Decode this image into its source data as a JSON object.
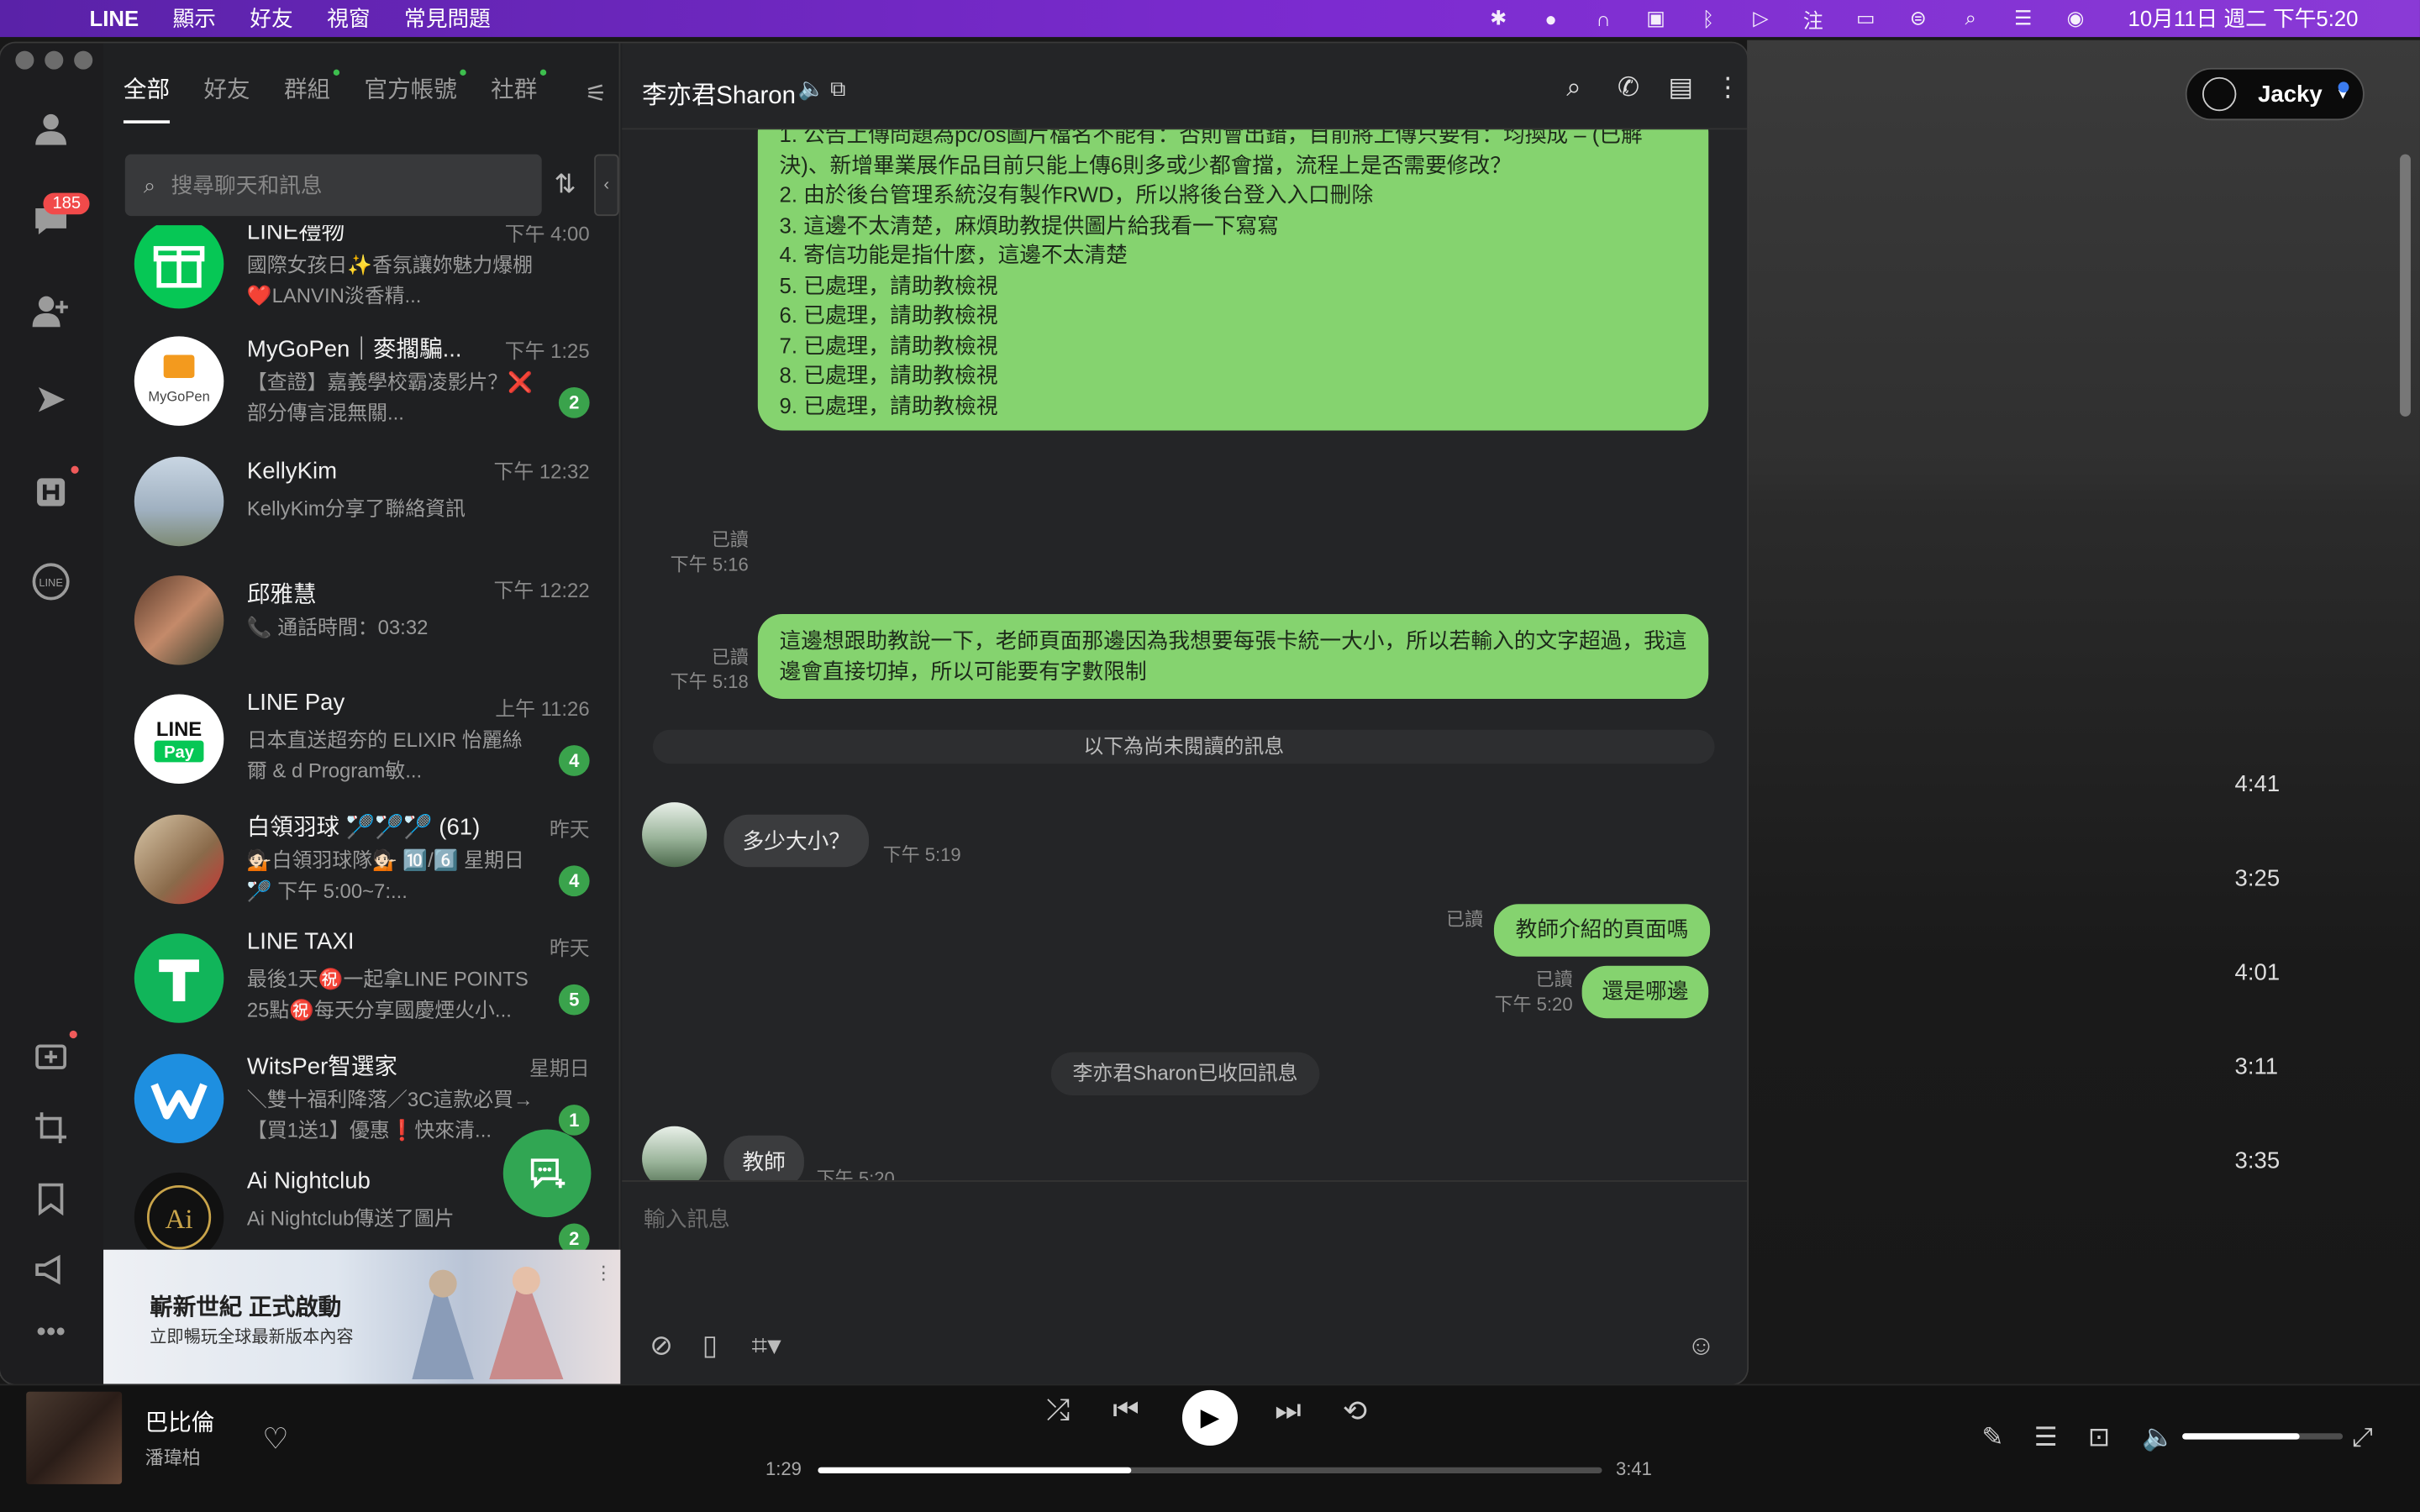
{
  "menubar": {
    "apple": "",
    "app": "LINE",
    "items": [
      "顯示",
      "好友",
      "視窗",
      "常見問題"
    ],
    "clock": "10月11日 週二 下午5:20"
  },
  "music": {
    "user": "Jacky",
    "durations": [
      "4:41",
      "3:25",
      "4:01",
      "3:11",
      "3:35"
    ]
  },
  "sidebar": {
    "badge_count": "185"
  },
  "tabs": [
    "全部",
    "好友",
    "群組",
    "官方帳號",
    "社群"
  ],
  "search": {
    "placeholder": "搜尋聊天和訊息"
  },
  "chats": [
    {
      "name": "LINE禮物",
      "time": "下午 4:00",
      "preview": "國際女孩日✨香氛讓妳魅力爆棚❤️LANVIN淡香精...",
      "unread": ""
    },
    {
      "name": "MyGoPen｜麥擱騙...",
      "time": "下午 1:25",
      "preview": "【查證】嘉義學校霸凌影片？❌部分傳言混無關...",
      "unread": "2"
    },
    {
      "name": "KellyKim",
      "time": "下午 12:32",
      "preview": "KellyKim分享了聯絡資訊",
      "unread": ""
    },
    {
      "name": "邱雅慧",
      "time": "下午 12:22",
      "preview": "📞 通話時間：03:32",
      "unread": ""
    },
    {
      "name": "LINE Pay",
      "time": "上午 11:26",
      "preview": "日本直送超夯的 ELIXIR 怡麗絲爾 & d Program敏...",
      "unread": "4"
    },
    {
      "name": "白領羽球 🏸🏸🏸 (61)",
      "time": "昨天",
      "preview": "💁🏻白領羽球隊💁🏻 🔟/6️⃣ 星期日🏸 下午 5:00~7:...",
      "unread": "4"
    },
    {
      "name": "LINE TAXI",
      "time": "昨天",
      "preview": "最後1天㊗️一起拿LINE POINTS 25點㊗️每天分享國慶煙火小...",
      "unread": "5"
    },
    {
      "name": "WitsPer智選家",
      "time": "星期日",
      "preview": "＼雙十福利降落／3C這款必買→【買1送1】優惠❗快來清...",
      "unread": "1"
    },
    {
      "name": "Ai Nightclub",
      "time": "",
      "preview": "Ai Nightclub傳送了圖片",
      "unread": "2"
    }
  ],
  "ad": {
    "headline": "嶄新世紀 正式啟動",
    "sub": "立即暢玩全球最新版本內容",
    "corner": "⋮"
  },
  "conversation": {
    "title": "李亦君Sharon",
    "long_message_lines": [
      "1. 公告上傳問題為pc/os圖片檔名不能有：否則會出錯，目前將上傳只要有：均換成 – (已解",
      "決)、新增畢業展作品目前只能上傳6則多或少都會擋，流程上是否需要修改？",
      "2. 由於後台管理系統沒有製作RWD，所以將後台登入入口刪除",
      "3. 這邊不太清楚，麻煩助教提供圖片給我看一下寫寫",
      "4. 寄信功能是指什麼，這邊不太清楚",
      "5. 已處理，請助教檢視",
      "6. 已處理，請助教檢視",
      "7. 已處理，請助教檢視",
      "8. 已處理，請助教檢視",
      "9. 已處理，請助教檢視"
    ],
    "read_label": "已讀",
    "t516": "下午 5:16",
    "msg2": "這邊想跟助教說一下，老師頁面那邊因為我想要每張卡統一大小，所以若輸入的文字超過，我這邊會直接切掉，所以可能要有字數限制",
    "t518": "下午 5:18",
    "unread_divider": "以下為尚未閱讀的訊息",
    "in1": "多少大小？",
    "t519": "下午 5:19",
    "out3": "教師介紹的頁面嗎",
    "out4": "還是哪邊",
    "t520": "下午 5:20",
    "recalled": "李亦君Sharon已收回訊息",
    "in2": "教師",
    "input_placeholder": "輸入訊息"
  },
  "player": {
    "song": "巴比倫",
    "artist": "潘瑋柏",
    "elapsed": "1:29",
    "total": "3:41",
    "progress": 0.4,
    "volume": 0.73
  }
}
